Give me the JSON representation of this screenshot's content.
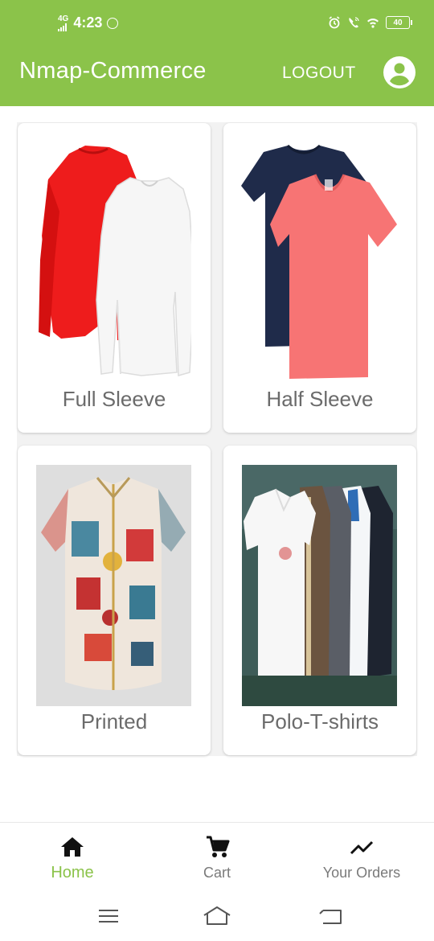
{
  "status_bar": {
    "network": "4G",
    "time": "4:23",
    "battery": "40"
  },
  "app_bar": {
    "title": "Nmap-Commerce",
    "logout_label": "LOGOUT",
    "account_icon": "account-circle-icon"
  },
  "categories": [
    {
      "label": "Full Sleeve"
    },
    {
      "label": "Half Sleeve"
    },
    {
      "label": "Printed"
    },
    {
      "label": "Polo-T-shirts"
    }
  ],
  "bottom_nav": {
    "items": [
      {
        "label": "Home",
        "icon": "home-icon",
        "active": true
      },
      {
        "label": "Cart",
        "icon": "cart-icon",
        "active": false
      },
      {
        "label": "Your Orders",
        "icon": "trending-up-icon",
        "active": false
      }
    ]
  },
  "colors": {
    "primary": "#8bc34a",
    "label_text": "#6b6b6b"
  }
}
